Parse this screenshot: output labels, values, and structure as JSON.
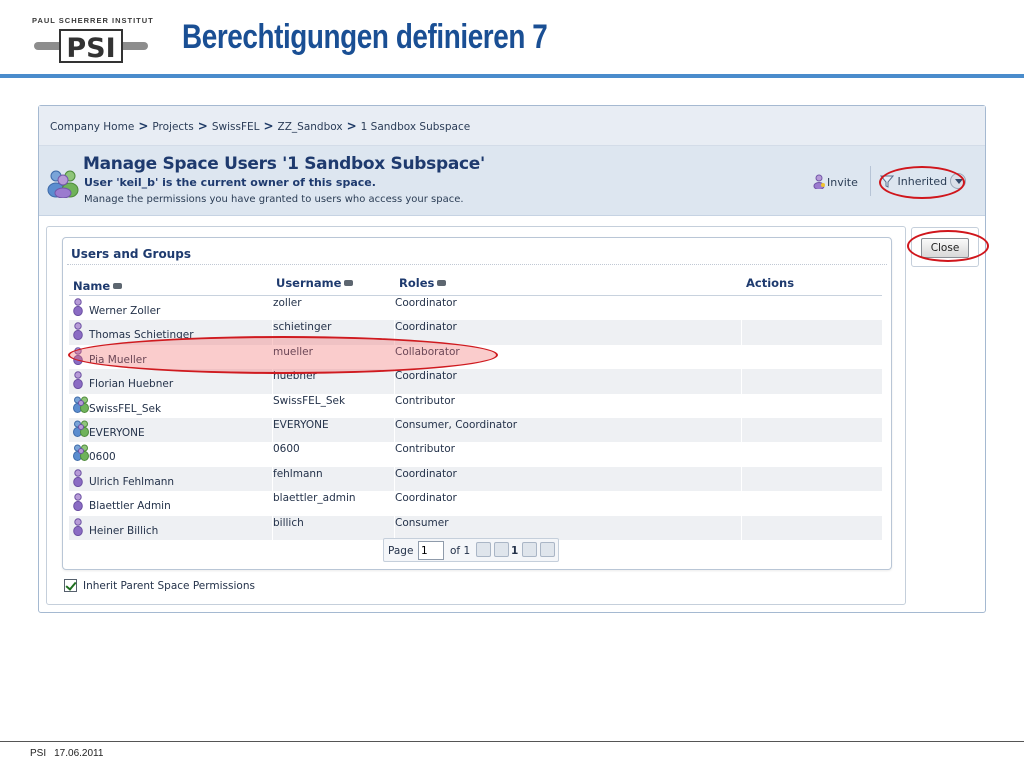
{
  "slide": {
    "logo_text": "PAUL SCHERRER INSTITUT",
    "logo_mark": "PSI",
    "title": "Berechtigungen definieren 7",
    "footer_org": "PSI",
    "footer_date": "17.06.2011"
  },
  "breadcrumb": {
    "items": [
      "Company Home",
      "Projects",
      "SwissFEL",
      "ZZ_Sandbox",
      "1 Sandbox Subspace"
    ],
    "separator": ">"
  },
  "header": {
    "title": "Manage Space Users '1 Sandbox Subspace'",
    "owner_text": "User 'keil_b' is the current owner of this space.",
    "description": "Manage the permissions you have granted to users who access your space.",
    "invite_label": "Invite",
    "inherited_label": "Inherited"
  },
  "close_button": {
    "label": "Close"
  },
  "users_groups": {
    "title": "Users and Groups",
    "columns": {
      "name": "Name",
      "username": "Username",
      "roles": "Roles",
      "actions": "Actions"
    },
    "rows": [
      {
        "type": "user",
        "name": "Werner Zoller",
        "username": "zoller",
        "roles": "Coordinator"
      },
      {
        "type": "user",
        "name": "Thomas Schietinger",
        "username": "schietinger",
        "roles": "Coordinator"
      },
      {
        "type": "user",
        "name": "Pia Mueller",
        "username": "mueller",
        "roles": "Collaborator"
      },
      {
        "type": "user",
        "name": "Florian Huebner",
        "username": "huebner",
        "roles": "Coordinator"
      },
      {
        "type": "group",
        "name": "SwissFEL_Sek",
        "username": "SwissFEL_Sek",
        "roles": "Contributor"
      },
      {
        "type": "group",
        "name": "EVERYONE",
        "username": "EVERYONE",
        "roles": "Consumer, Coordinator"
      },
      {
        "type": "group",
        "name": "0600",
        "username": "0600",
        "roles": "Contributor"
      },
      {
        "type": "user",
        "name": "Ulrich Fehlmann",
        "username": "fehlmann",
        "roles": "Coordinator"
      },
      {
        "type": "user",
        "name": "Blaettler Admin",
        "username": "blaettler_admin",
        "roles": "Coordinator"
      },
      {
        "type": "user",
        "name": "Heiner Billich",
        "username": "billich",
        "roles": "Consumer"
      }
    ],
    "pager": {
      "page_label": "Page",
      "page_value": "1",
      "of_label": "of 1",
      "current": "1"
    }
  },
  "inherit_permissions": {
    "label": "Inherit Parent Space Permissions",
    "checked": true
  },
  "colors": {
    "accent_blue": "#1a4f94",
    "rule_blue": "#4a8ccc",
    "highlight_red": "#d0161c"
  }
}
